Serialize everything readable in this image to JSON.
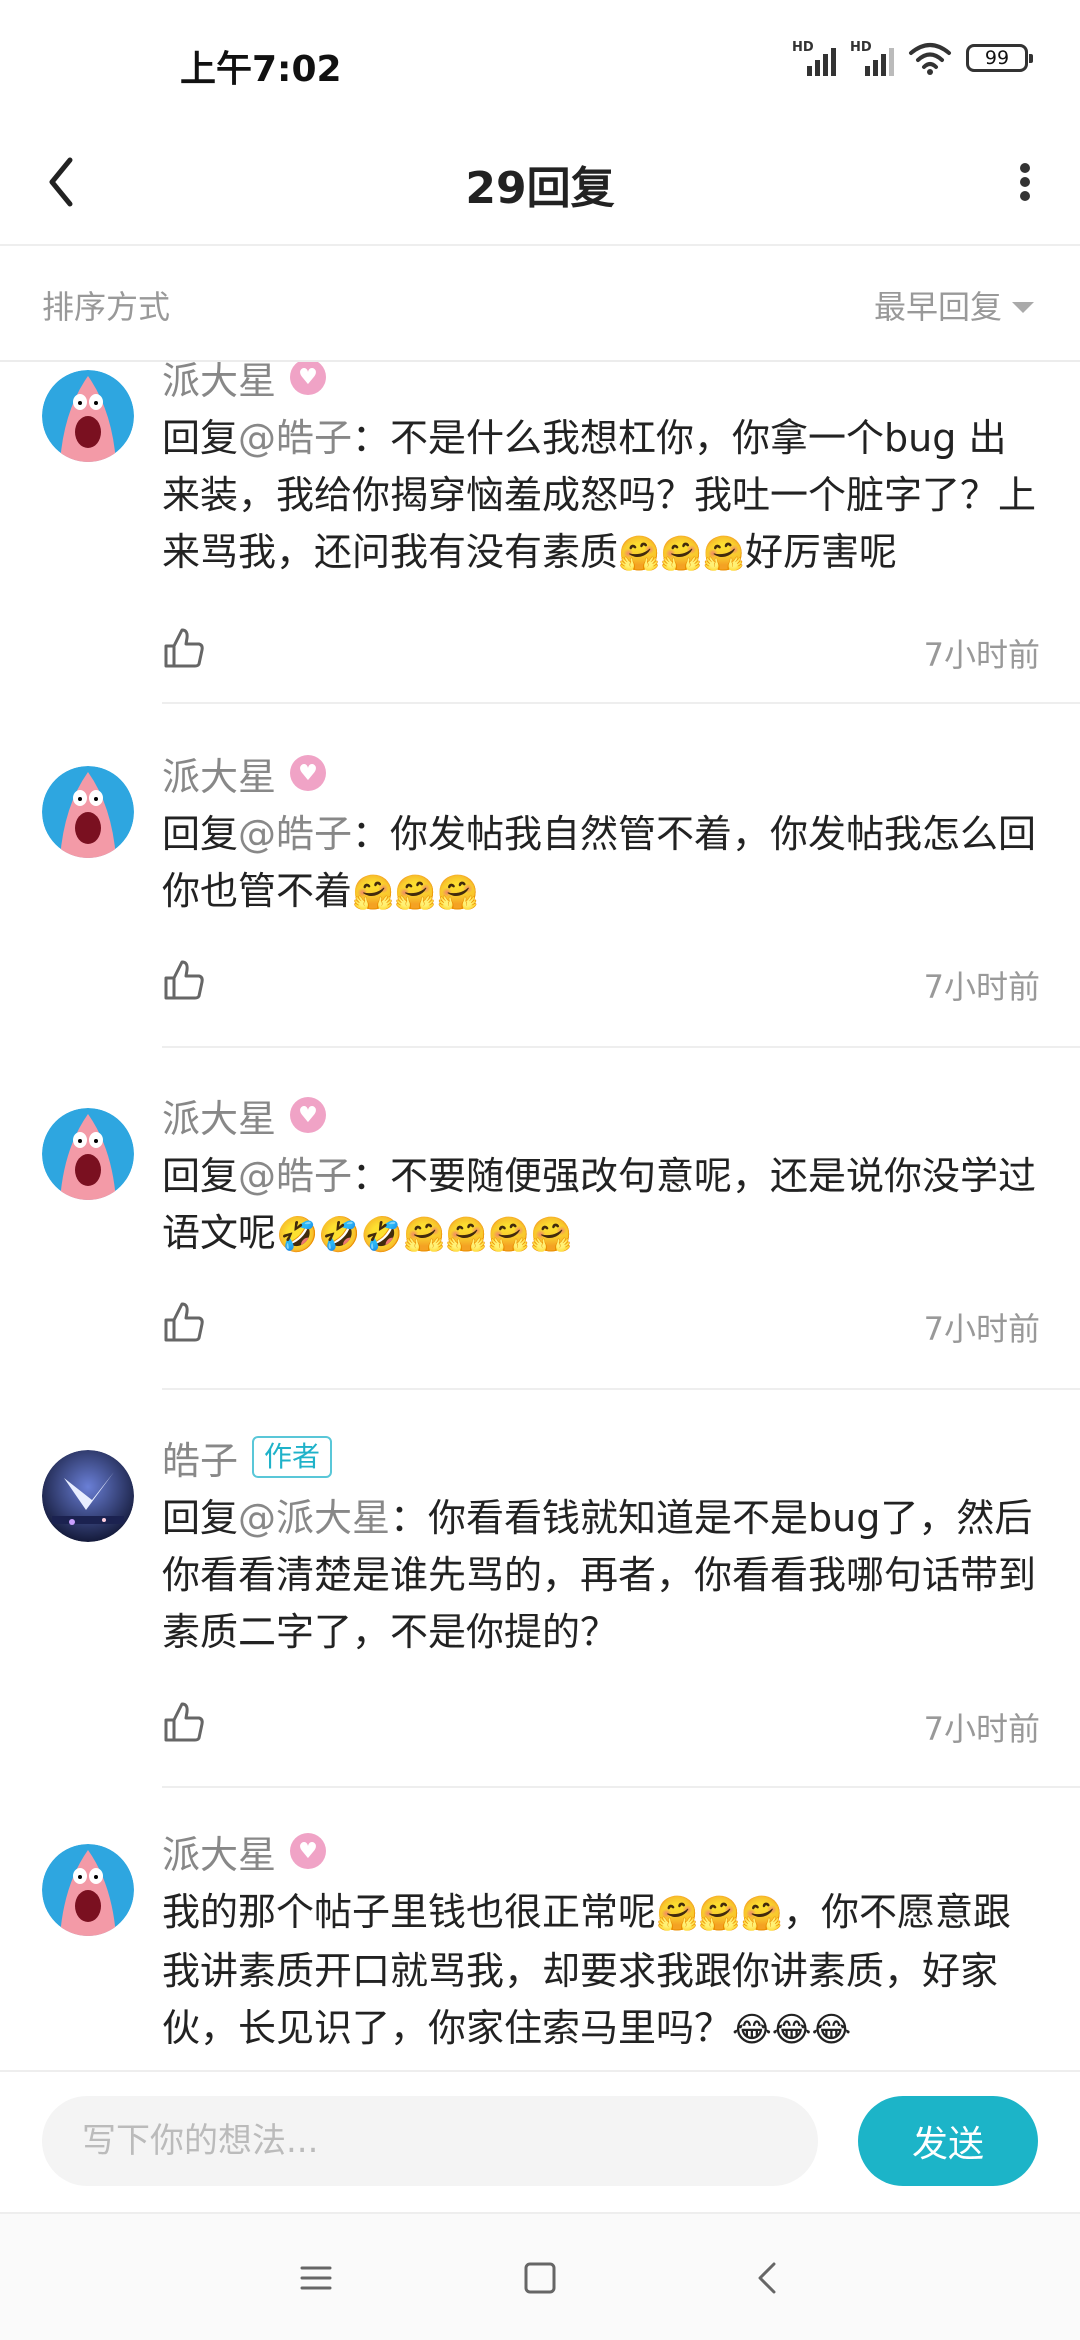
{
  "status": {
    "time": "上午7:02",
    "battery": "99",
    "signal1": "HD",
    "signal2": "HD"
  },
  "header": {
    "title": "29回复"
  },
  "sort": {
    "label": "排序方式",
    "selected": "最早回复"
  },
  "comments": [
    {
      "name": "派大星",
      "reply_prefix": "回复",
      "mention": "@皓子",
      "text": "：不是什么我想杠你，你拿一个bug 出来装，我给你揭穿恼羞成怒吗？我吐一个脏字了？上来骂我，还问我有没有素质",
      "emoji_after": "🤗🤗🤗",
      "tail": "好厉害呢",
      "time": "7小时前"
    },
    {
      "name": "派大星",
      "reply_prefix": "回复",
      "mention": "@皓子",
      "text": "：你发帖我自然管不着，你发帖我怎么回你也管不着",
      "emoji_after": "🤗🤗🤗",
      "tail": "",
      "time": "7小时前"
    },
    {
      "name": "派大星",
      "reply_prefix": "回复",
      "mention": "@皓子",
      "text": "：不要随便强改句意呢，还是说你没学过语文呢",
      "emoji_after": "🤣🤣🤣🤗🤗🤗🤗",
      "tail": "",
      "time": "7小时前"
    },
    {
      "name": "皓子",
      "author_tag": "作者",
      "reply_prefix": "回复",
      "mention": "@派大星",
      "text": "：你看看钱就知道是不是bug了，然后你看看清楚是谁先骂的，再者，你看看我哪句话带到素质二字了，不是你提的？",
      "emoji_after": "",
      "tail": "",
      "time": "7小时前"
    },
    {
      "name": "派大星",
      "reply_prefix": "",
      "mention": "",
      "text": "我的那个帖子里钱也很正常呢",
      "emoji_after": "🤗🤗🤗",
      "tail": "，你不愿意跟我讲素质开口就骂我，却要求我跟你讲素质，好家伙，长见识了，你家住索马里吗？",
      "emoji_tail": "😂😂😂",
      "time": ""
    }
  ],
  "input": {
    "placeholder": "写下你的想法..."
  },
  "send": {
    "label": "发送"
  },
  "colors": {
    "accent": "#1cb4c8",
    "muted": "#999999",
    "divider": "#eeeeee"
  },
  "icons": {
    "back": "back-arrow-icon",
    "more": "more-vertical-icon",
    "like": "thumbs-up-icon",
    "menu": "menu-icon",
    "home": "home-square-icon",
    "nav_back": "nav-back-icon"
  }
}
